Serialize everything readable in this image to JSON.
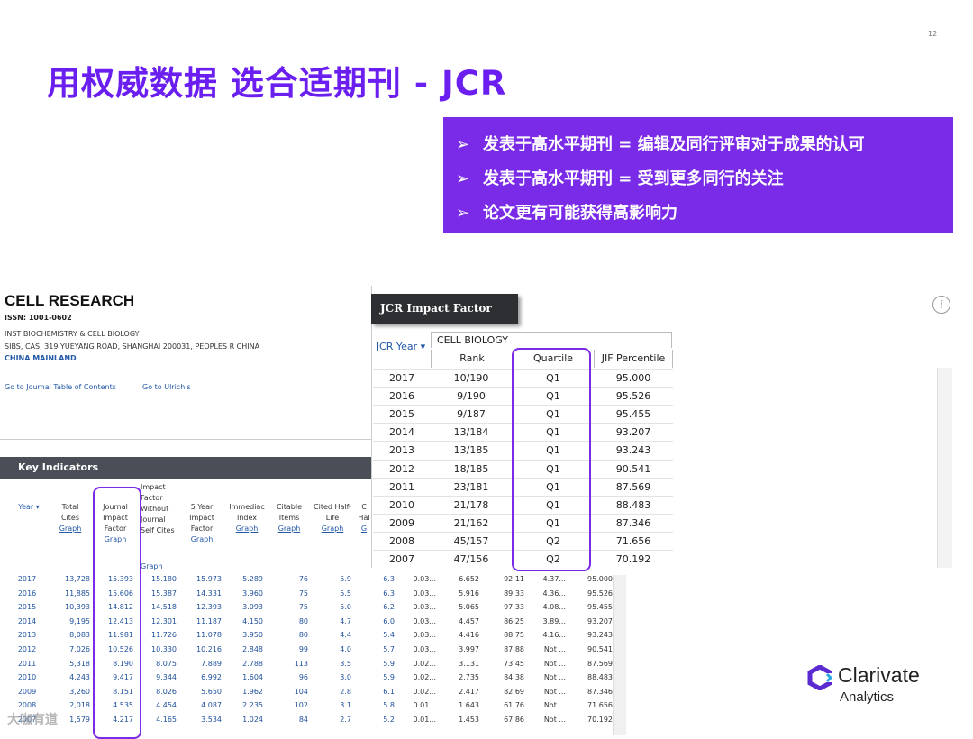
{
  "page_number": "12",
  "slide_title": "用权威数据 选合适期刊 - JCR",
  "callout": {
    "arrow": "➢",
    "bullets": [
      "发表于高水平期刊 = 编辑及同行评审对于成果的认可",
      "发表于高水平期刊 = 受到更多同行的关注",
      "论文更有可能获得高影响力"
    ]
  },
  "journal": {
    "title": "CELL RESEARCH",
    "issn": "ISSN: 1001-0602",
    "org": "INST BIOCHEMISTRY & CELL BIOLOGY",
    "address": "SIBS, CAS, 319 YUEYANG ROAD, SHANGHAI 200031, PEOPLES R CHINA",
    "country": "CHINA MAINLAND",
    "link_toc": "Go to Journal Table of Contents",
    "link_ulrich": "Go to Ulrich's"
  },
  "key_indicators": {
    "title": "Key Indicators",
    "headers": {
      "year": "Year ▾",
      "total_cites": "Total Cites",
      "jif": "Journal Impact Factor",
      "jif_wo_self": "Impact Factor Without Journal Self Cites",
      "five_year": "5 Year Impact Factor",
      "immediacy": "Immediac Index",
      "citable": "Citable Items",
      "cited_half": "Cited Half-Life",
      "c_half": "C Hal",
      "graph": "Graph",
      "graph_g": "G"
    },
    "rows": [
      [
        "2017",
        "13,728",
        "15.393",
        "15.180",
        "15.973",
        "5.289",
        "76",
        "5.9",
        "6.3",
        "0.03...",
        "6.652",
        "92.11",
        "4.37...",
        "95.000"
      ],
      [
        "2016",
        "11,885",
        "15.606",
        "15.387",
        "14.331",
        "3.960",
        "75",
        "5.5",
        "6.3",
        "0.03...",
        "5.916",
        "89.33",
        "4.36...",
        "95.526"
      ],
      [
        "2015",
        "10,393",
        "14.812",
        "14.518",
        "12.393",
        "3.093",
        "75",
        "5.0",
        "6.2",
        "0.03...",
        "5.065",
        "97.33",
        "4.08...",
        "95.455"
      ],
      [
        "2014",
        "9,195",
        "12.413",
        "12.301",
        "11.187",
        "4.150",
        "80",
        "4.7",
        "6.0",
        "0.03...",
        "4.457",
        "86.25",
        "3.89...",
        "93.207"
      ],
      [
        "2013",
        "8,083",
        "11.981",
        "11.726",
        "11.078",
        "3.950",
        "80",
        "4.4",
        "5.4",
        "0.03...",
        "4.416",
        "88.75",
        "4.16...",
        "93.243"
      ],
      [
        "2012",
        "7,026",
        "10.526",
        "10.330",
        "10.216",
        "2.848",
        "99",
        "4.0",
        "5.7",
        "0.03...",
        "3.997",
        "87.88",
        "Not ...",
        "90.541"
      ],
      [
        "2011",
        "5,318",
        "8.190",
        "8.075",
        "7.889",
        "2.788",
        "113",
        "3.5",
        "5.9",
        "0.02...",
        "3.131",
        "73.45",
        "Not ...",
        "87.569"
      ],
      [
        "2010",
        "4,243",
        "9.417",
        "9.344",
        "6.992",
        "1.604",
        "96",
        "3.0",
        "5.9",
        "0.02...",
        "2.735",
        "84.38",
        "Not ...",
        "88.483"
      ],
      [
        "2009",
        "3,260",
        "8.151",
        "8.026",
        "5.650",
        "1.962",
        "104",
        "2.8",
        "6.1",
        "0.02...",
        "2.417",
        "82.69",
        "Not ...",
        "87.346"
      ],
      [
        "2008",
        "2,018",
        "4.535",
        "4.454",
        "4.087",
        "2.235",
        "102",
        "3.1",
        "5.8",
        "0.01...",
        "1.643",
        "61.76",
        "Not ...",
        "71.656"
      ],
      [
        "2007",
        "1,579",
        "4.217",
        "4.165",
        "3.534",
        "1.024",
        "84",
        "2.7",
        "5.2",
        "0.01...",
        "1.453",
        "67.86",
        "Not ...",
        "70.192"
      ]
    ]
  },
  "jcr": {
    "header": "JCR Impact Factor",
    "info": "i",
    "category": "CELL BIOLOGY",
    "col_year": "JCR Year ▾",
    "col_rank": "Rank",
    "col_quartile": "Quartile",
    "col_percentile": "JIF Percentile",
    "rows": [
      [
        "2017",
        "10/190",
        "Q1",
        "95.000"
      ],
      [
        "2016",
        "9/190",
        "Q1",
        "95.526"
      ],
      [
        "2015",
        "9/187",
        "Q1",
        "95.455"
      ],
      [
        "2014",
        "13/184",
        "Q1",
        "93.207"
      ],
      [
        "2013",
        "13/185",
        "Q1",
        "93.243"
      ],
      [
        "2012",
        "18/185",
        "Q1",
        "90.541"
      ],
      [
        "2011",
        "23/181",
        "Q1",
        "87.569"
      ],
      [
        "2010",
        "21/178",
        "Q1",
        "88.483"
      ],
      [
        "2009",
        "21/162",
        "Q1",
        "87.346"
      ],
      [
        "2008",
        "45/157",
        "Q2",
        "71.656"
      ],
      [
        "2007",
        "47/156",
        "Q2",
        "70.192"
      ]
    ]
  },
  "logo": {
    "line1": "Clarivate",
    "line2": "Analytics"
  },
  "watermark": "大咖有道",
  "colors": {
    "accent": "#6a1ef0",
    "callout_bg": "#7a2be8",
    "link": "#2459a8"
  }
}
